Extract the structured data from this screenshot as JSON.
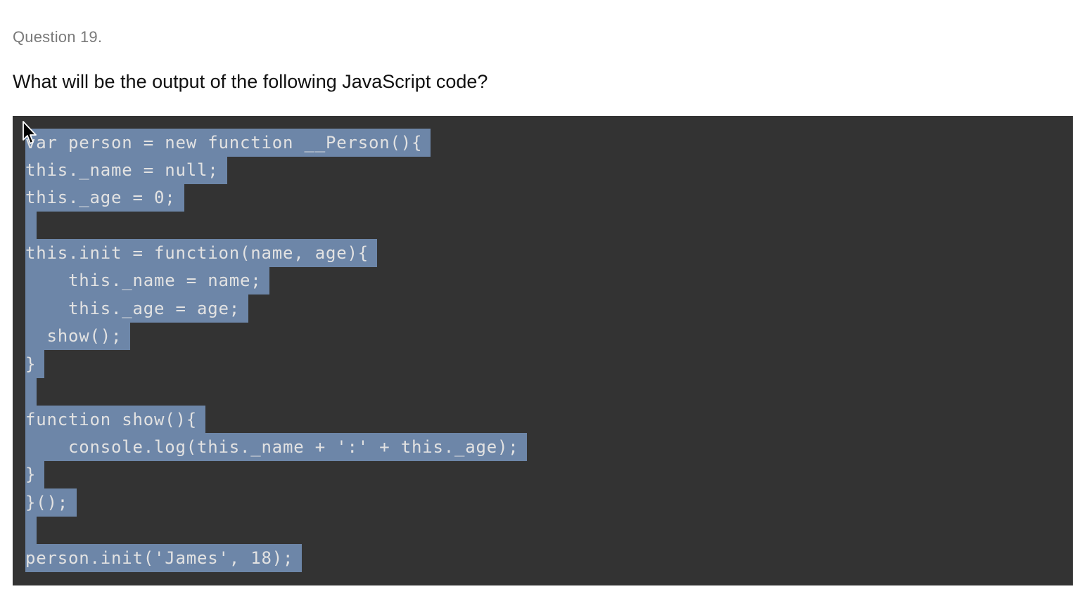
{
  "question": {
    "number_label": "Question 19.",
    "prompt": "What will be the output of the following JavaScript code?"
  },
  "code": {
    "lines": [
      "var person = new function __Person(){",
      "this._name = null;",
      "this._age = 0;",
      "",
      "this.init = function(name, age){",
      "    this._name = name;",
      "    this._age = age;",
      "  show();",
      "}",
      "",
      "function show(){",
      "    console.log(this._name + ':' + this._age);",
      "}",
      "}();",
      "",
      "person.init('James', 18);"
    ]
  },
  "colors": {
    "code_background": "#333333",
    "selection": "#6d86a8",
    "code_text": "#e2e2e2"
  },
  "icons": {
    "cursor": "mouse-pointer-icon"
  }
}
